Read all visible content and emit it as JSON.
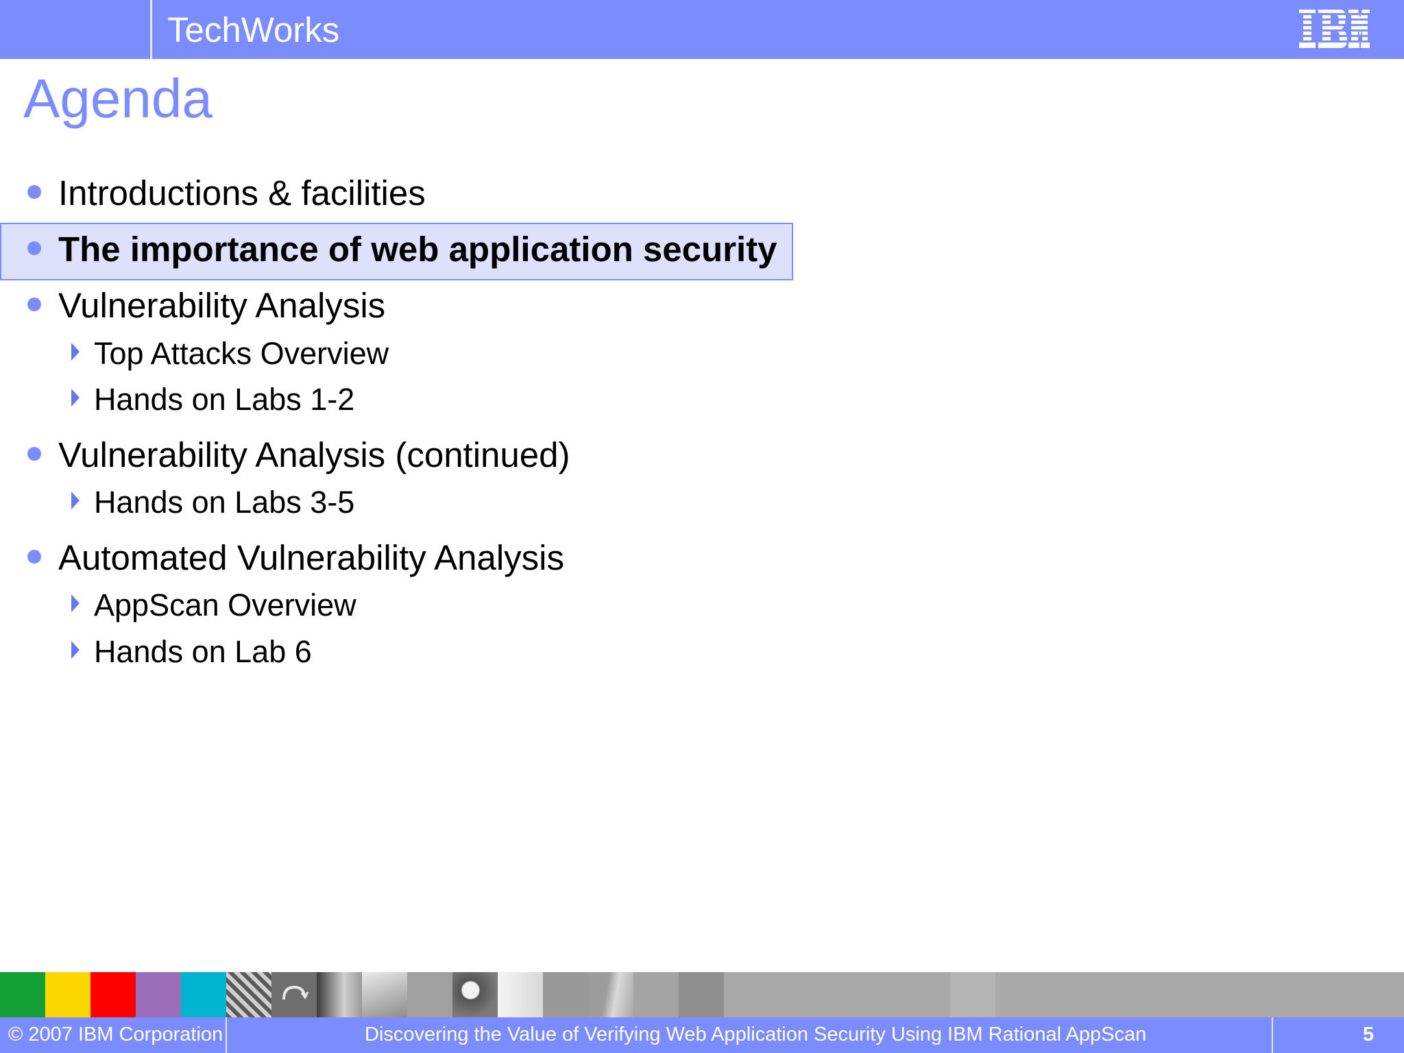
{
  "header": {
    "title": "TechWorks",
    "logo_text": "IBM",
    "bar_color": "#7b8cff"
  },
  "slide": {
    "title": "Agenda",
    "items": [
      {
        "level": 1,
        "text": "Introductions & facilities",
        "bold": false
      },
      {
        "level": 1,
        "text": "The importance of web application security",
        "bold": true,
        "highlighted": true
      },
      {
        "level": 1,
        "text": "Vulnerability Analysis",
        "bold": false
      },
      {
        "level": 2,
        "text": "Top Attacks Overview"
      },
      {
        "level": 2,
        "text": "Hands on Labs 1-2"
      },
      {
        "level": 1,
        "text": "Vulnerability Analysis (continued)",
        "bold": false
      },
      {
        "level": 2,
        "text": "Hands on Labs 3-5"
      },
      {
        "level": 1,
        "text": "Automated Vulnerability Analysis",
        "bold": false
      },
      {
        "level": 2,
        "text": "AppScan Overview"
      },
      {
        "level": 2,
        "text": "Hands on Lab 6"
      }
    ]
  },
  "footer": {
    "copyright": "© 2007 IBM Corporation",
    "presentation_title": "Discovering the Value of Verifying Web Application Security Using IBM Rational AppScan",
    "page_number": "5"
  },
  "color_strip": [
    "#12a037",
    "#ffd700",
    "#ff0000",
    "#9b6fb8",
    "#00b4d0"
  ]
}
